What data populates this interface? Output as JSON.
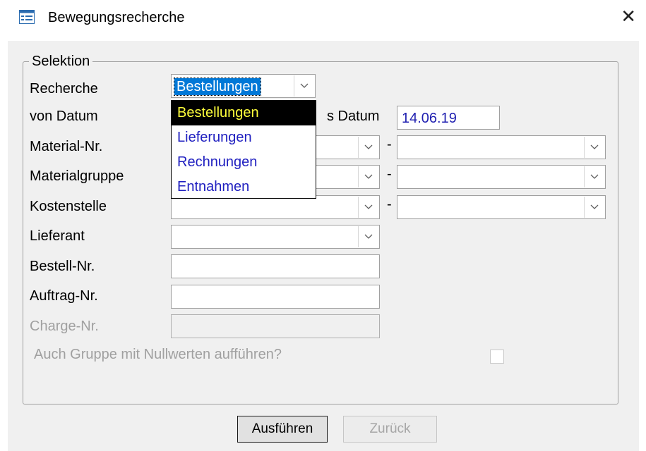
{
  "window": {
    "title": "Bewegungsrecherche",
    "close_glyph": "✕",
    "icon": "form-icon"
  },
  "group": {
    "legend": "Selektion"
  },
  "fields": {
    "recherche": {
      "label": "Recherche",
      "value": "Bestellungen"
    },
    "von_datum": {
      "label": "von Datum"
    },
    "bis_datum": {
      "label": "s Datum",
      "value": "14.06.19"
    },
    "material_nr": {
      "label": "Material-Nr.",
      "separator": "-"
    },
    "materialgruppe": {
      "label": "Materialgruppe",
      "separator": "-"
    },
    "kostenstelle": {
      "label": "Kostenstelle",
      "separator": "-"
    },
    "lieferant": {
      "label": "Lieferant"
    },
    "bestell_nr": {
      "label": "Bestell-Nr.",
      "value": ""
    },
    "auftrag_nr": {
      "label": "Auftrag-Nr.",
      "value": ""
    },
    "charge_nr": {
      "label": "Charge-Nr.",
      "value": ""
    },
    "nullwerte": {
      "label": "Auch Gruppe mit Nullwerten aufführen?",
      "checked": false
    }
  },
  "dropdown": {
    "options": [
      "Bestellungen",
      "Lieferungen",
      "Rechnungen",
      "Entnahmen"
    ],
    "highlighted": "Bestellungen"
  },
  "buttons": {
    "run_label": "Ausführen",
    "back_label": "Zurück"
  },
  "colors": {
    "selection_bg": "#0078d7",
    "dropdown_active_bg": "#000000",
    "dropdown_active_text": "#ffff3b",
    "value_text": "#1f1fb0",
    "disabled_text": "#a0a0a0"
  }
}
